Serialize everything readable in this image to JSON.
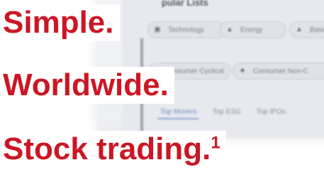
{
  "app_preview": {
    "title": "pular Lists",
    "chips_row1": [
      {
        "label": "Technology",
        "icon": "chip-icon"
      },
      {
        "label": "Energy",
        "icon": "tower-icon"
      },
      {
        "label": "Basic M",
        "icon": "tower-icon"
      }
    ],
    "chips_row2": [
      {
        "label": "Consumer Cyclical",
        "icon": "cart-icon"
      },
      {
        "label": "Consumer Non-C",
        "icon": "tree-icon"
      }
    ],
    "tabs": [
      "Top Movers",
      "Top ESG",
      "Top IPOs"
    ]
  },
  "headline": {
    "line1": "Simple.",
    "line2": "Worldwide.",
    "line3": "Stock trading.",
    "footnote_marker": "1"
  },
  "colors": {
    "headline": "#cc1624",
    "tab_active": "#6a8fc2"
  }
}
